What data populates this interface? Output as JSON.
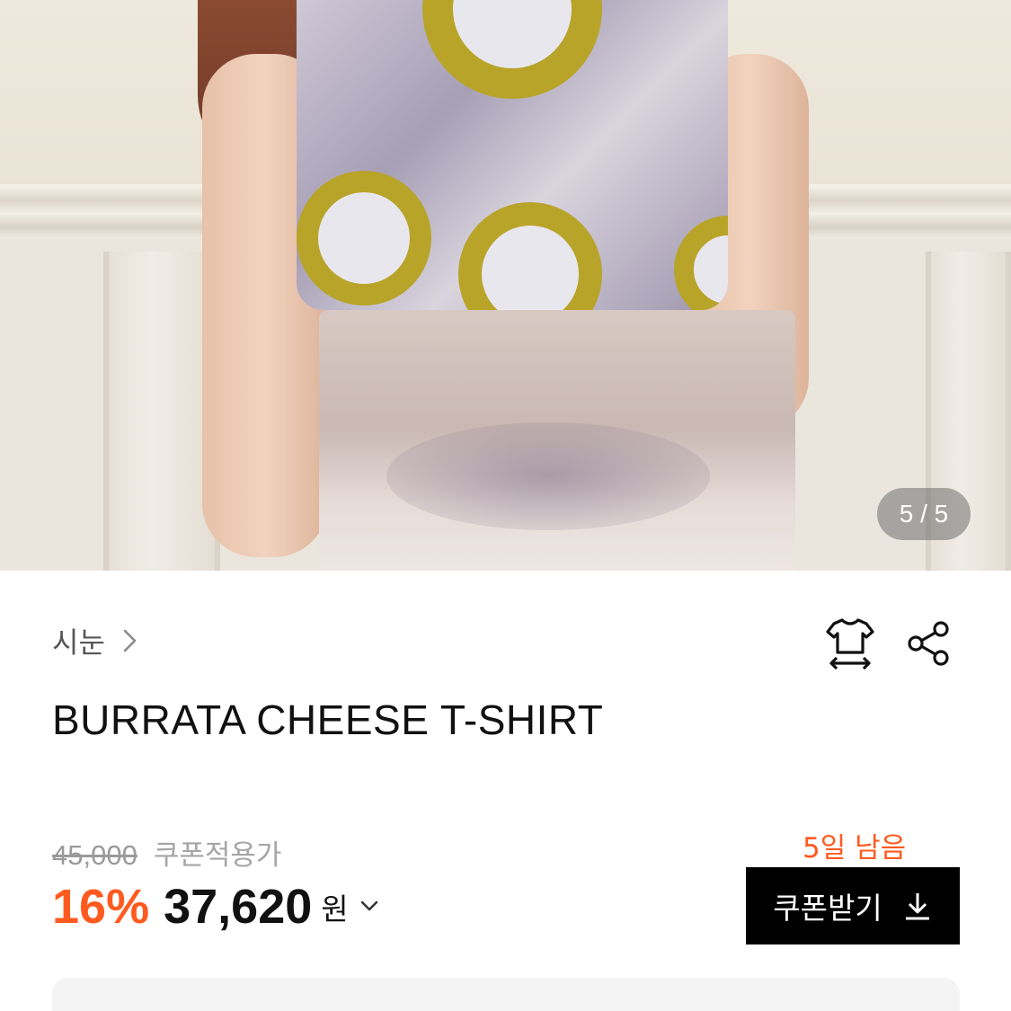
{
  "gallery": {
    "counter": "5 / 5",
    "current": 5,
    "total": 5
  },
  "product": {
    "brand": "시눈",
    "name": "BURRATA CHEESE T-SHIRT",
    "original_price": "45,000",
    "coupon_price_label": "쿠폰적용가",
    "discount": "16%",
    "price": "37,620",
    "currency": "원"
  },
  "coupon": {
    "days_left": "5일 남음",
    "button_label": "쿠폰받기"
  },
  "icons": {
    "size_guide": "tshirt-size-icon",
    "share": "share-icon",
    "download": "download-icon"
  },
  "colors": {
    "accent": "#ff5a1f",
    "button_bg": "#000000",
    "card_bg": "#f4f4f5"
  }
}
